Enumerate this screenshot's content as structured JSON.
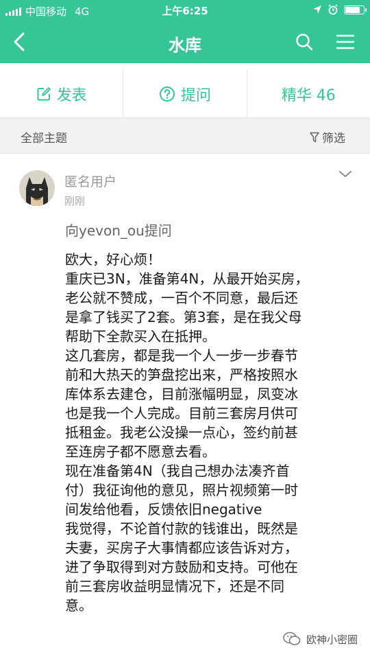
{
  "status": {
    "carrier": "中国移动",
    "network": "4G",
    "time": "上午6:25"
  },
  "nav": {
    "title": "水库",
    "back_icon": "chevron-left-icon",
    "search_icon": "search-icon",
    "menu_icon": "menu-icon"
  },
  "actions": [
    {
      "label": "发表",
      "icon": "edit-icon"
    },
    {
      "label": "提问",
      "icon": "question-icon"
    },
    {
      "label": "精华 46"
    }
  ],
  "filter": {
    "all_topics": "全部主题",
    "filter_label": "筛选"
  },
  "post": {
    "author": "匿名用户",
    "time": "刚刚",
    "question_to": "向yevon_ou提问",
    "lines": [
      "欧大，好心烦！",
      "重庆已3N，准备第4N，从最开始买房，",
      "老公就不赞成，一百个不同意，最后还",
      "是拿了钱买了2套。第3套，是在我父母",
      "帮助下全款买入在抵押。",
      "这几套房，都是我一个人一步一步春节",
      "前和大热天的笋盘挖出来，严格按照水",
      "库体系去建仓，目前涨幅明显，凤变冰",
      "也是我一个人完成。目前三套房月供可",
      "抵租金。我老公没操一点心，签约前甚",
      "至连房子都不愿意去看。",
      "现在准备第4N（我自己想办法凑齐首",
      "付）我征询他的意见，照片视频第一时",
      "间发给他看，反馈依旧negative",
      "我觉得，不论首付款的钱谁出，既然是",
      "夫妻，买房子大事情都应该告诉对方，",
      "进了争取得到对方鼓励和支持。可他在",
      "前三套房收益明显情况下，还是不同",
      "意。"
    ]
  },
  "watermark": "欧神小密圈",
  "colors": {
    "accent": "#35c596",
    "filter_bg": "#f2f2f2"
  }
}
